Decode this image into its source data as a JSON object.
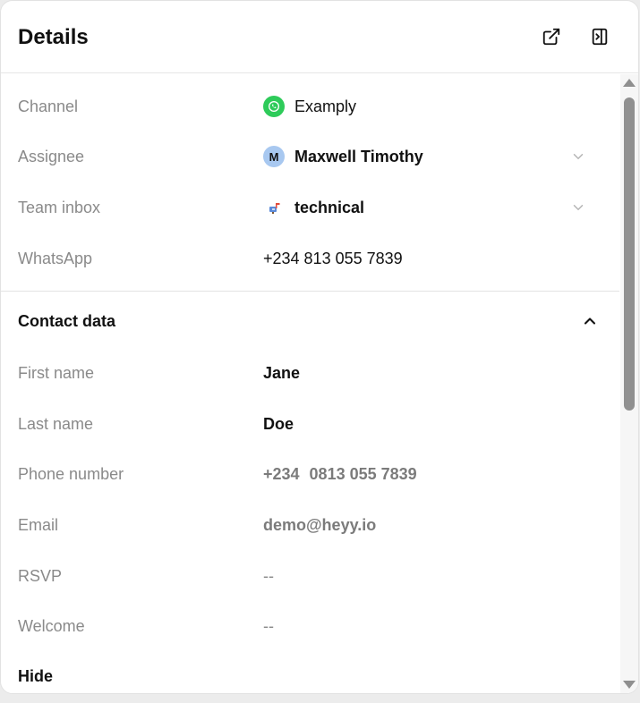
{
  "header": {
    "title": "Details"
  },
  "details": [
    {
      "label": "Channel",
      "value": "Exampl​y",
      "icon": "whatsapp-icon"
    },
    {
      "label": "Assignee",
      "value": "Maxwell Timothy",
      "avatar_letter": "M"
    },
    {
      "label": "Team inbox",
      "value": "technical",
      "icon": "mailbox-icon"
    },
    {
      "label": "WhatsApp",
      "value": "+234 813 055 7839"
    }
  ],
  "contact": {
    "title": "Contact data",
    "fields": [
      {
        "label": "First name",
        "value": "Jane"
      },
      {
        "label": "Last name",
        "value": "Doe"
      },
      {
        "label": "Phone number",
        "code": "+234",
        "value": "0813 055 7839"
      },
      {
        "label": "Email",
        "value": "demo@heyy.io"
      },
      {
        "label": "RSVP",
        "value": "--"
      },
      {
        "label": "Welcome",
        "value": "--"
      }
    ],
    "hide_label": "Hide"
  },
  "colors": {
    "whatsapp": "#2ecb5a",
    "avatar_bg": "#a8c8f0",
    "label": "#8a8a8a"
  }
}
